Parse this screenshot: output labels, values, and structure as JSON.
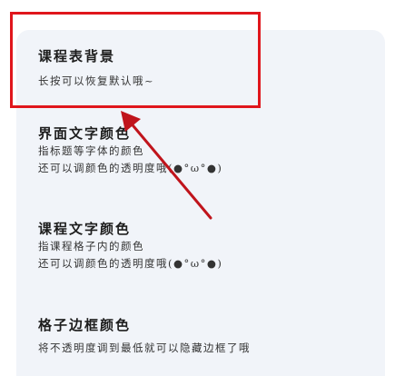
{
  "settings": {
    "items": [
      {
        "title": "课程表背景",
        "desc": [
          "长按可以恢复默认哦~"
        ]
      },
      {
        "title": "界面文字颜色",
        "desc": [
          "指标题等字体的颜色",
          "还可以调颜色的透明度哦(●°ω°●)"
        ]
      },
      {
        "title": "课程文字颜色",
        "desc": [
          "指课程格子内的颜色",
          "还可以调颜色的透明度哦(●°ω°●)"
        ]
      },
      {
        "title": "格子边框颜色",
        "desc": [
          "将不透明度调到最低就可以隐藏边框了哦"
        ]
      }
    ]
  },
  "annotation": {
    "box_color": "#e0161c",
    "arrow_color": "#c0141c"
  }
}
